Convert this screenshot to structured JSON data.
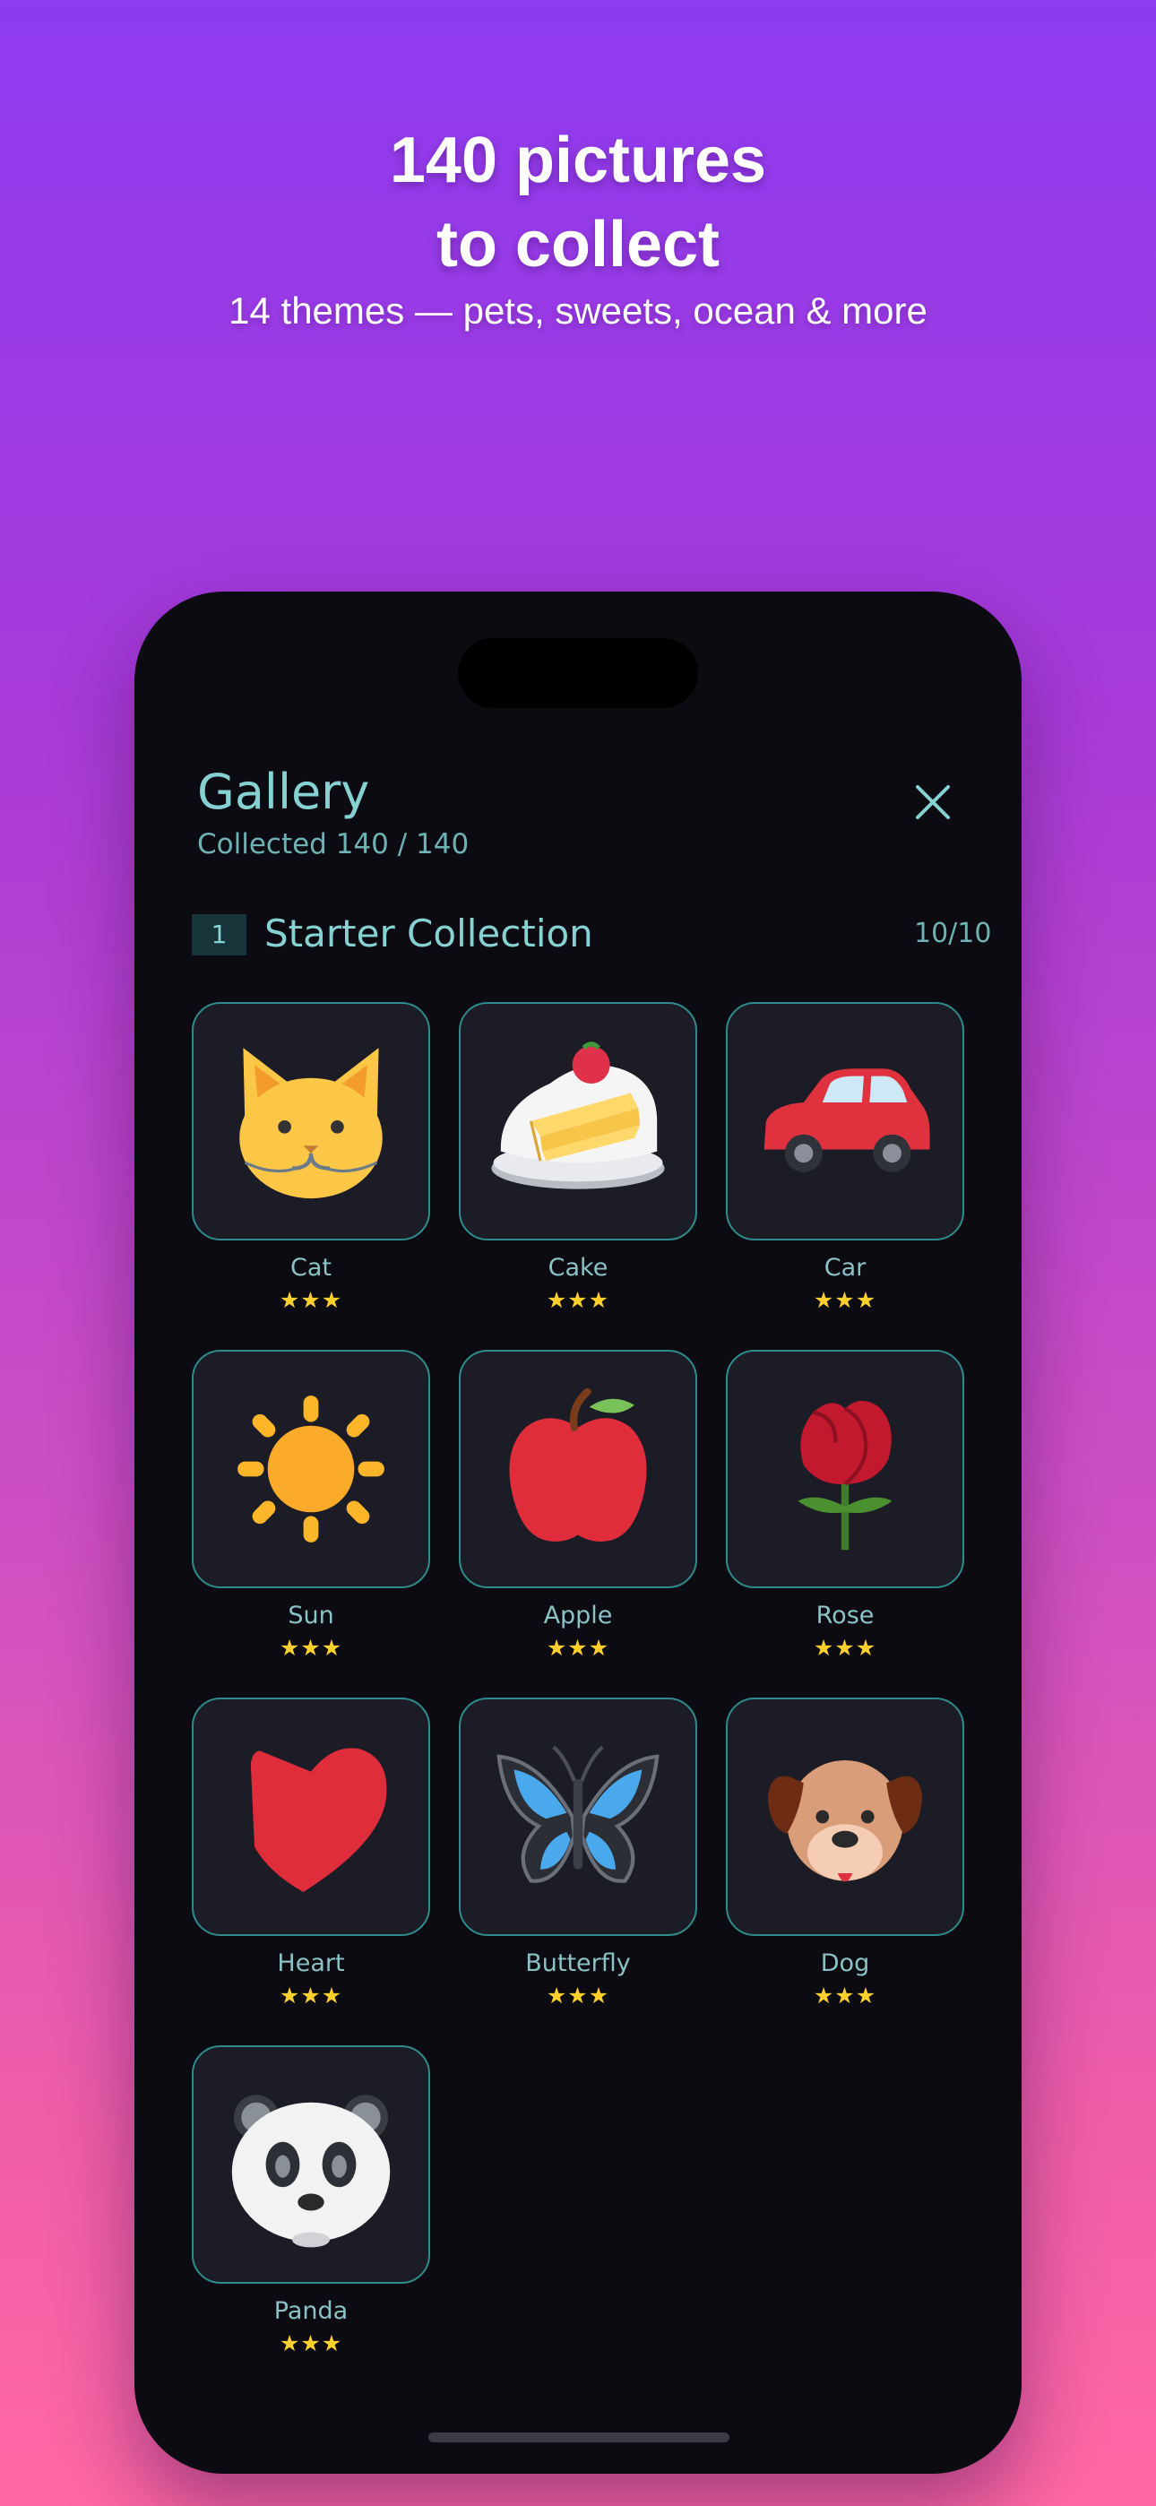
{
  "promo": {
    "title_line1": "140 pictures",
    "title_line2": "to collect",
    "subtitle": "14 themes — pets, sweets, ocean & more"
  },
  "gallery": {
    "title": "Gallery",
    "collected_text": "Collected 140 / 140"
  },
  "section": {
    "number": "1",
    "name": "Starter Collection",
    "count": "10/10"
  },
  "items": [
    {
      "label": "Cat",
      "stars": "★★★",
      "icon": "cat-icon"
    },
    {
      "label": "Cake",
      "stars": "★★★",
      "icon": "cake-icon"
    },
    {
      "label": "Car",
      "stars": "★★★",
      "icon": "car-icon"
    },
    {
      "label": "Sun",
      "stars": "★★★",
      "icon": "sun-icon"
    },
    {
      "label": "Apple",
      "stars": "★★★",
      "icon": "apple-icon"
    },
    {
      "label": "Rose",
      "stars": "★★★",
      "icon": "rose-icon"
    },
    {
      "label": "Heart",
      "stars": "★★★",
      "icon": "heart-icon"
    },
    {
      "label": "Butterfly",
      "stars": "★★★",
      "icon": "butterfly-icon"
    },
    {
      "label": "Dog",
      "stars": "★★★",
      "icon": "dog-icon"
    },
    {
      "label": "Panda",
      "stars": "★★★",
      "icon": "panda-icon"
    }
  ],
  "colors": {
    "accent_teal": "#86d2d2",
    "tile_border": "#2f8c8c",
    "star": "#ffcf2e",
    "phone_bg": "#0b0b11",
    "bg_top": "#8e3bf1",
    "bg_bottom": "#ff68a3"
  }
}
